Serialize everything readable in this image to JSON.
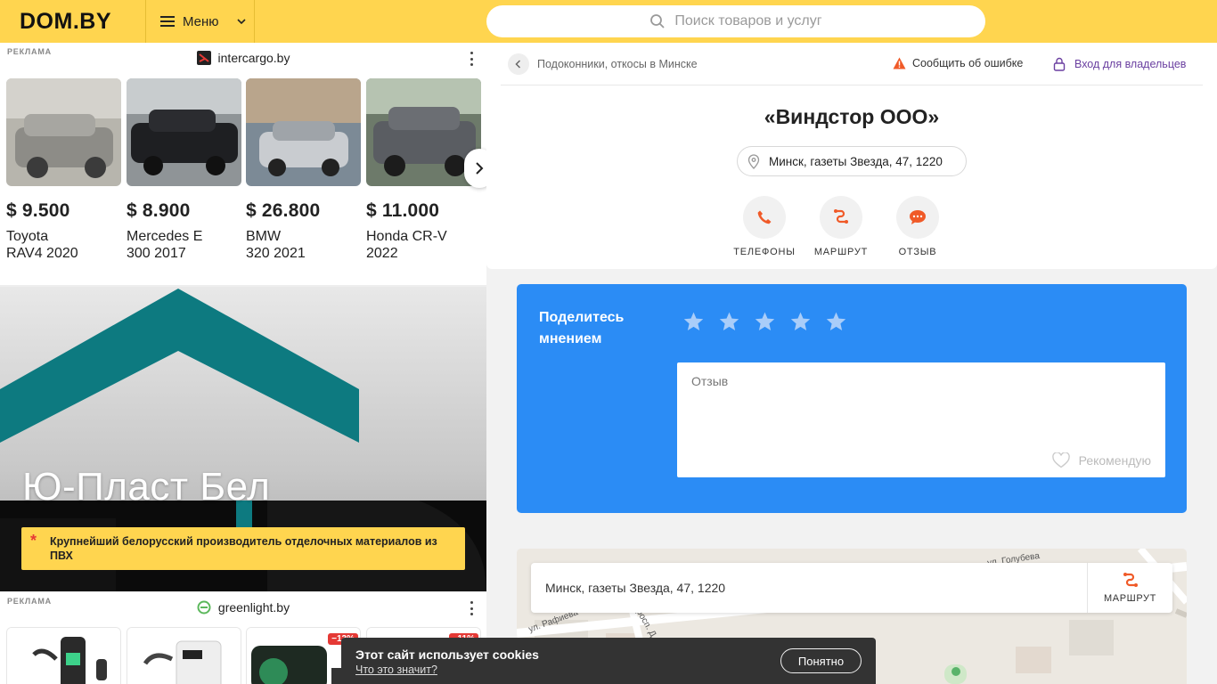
{
  "header": {
    "logo": "DOM.BY",
    "menu_label": "Меню",
    "search_placeholder": "Поиск товаров и услуг"
  },
  "ads": {
    "label": "РЕКЛАМА",
    "block1_brand": "intercargo.by",
    "cars": [
      {
        "price": "$ 9.500",
        "title_line1": "Toyota",
        "title_line2": "RAV4 2020"
      },
      {
        "price": "$ 8.900",
        "title_line1": "Mercedes E",
        "title_line2": "300 2017"
      },
      {
        "price": "$ 26.800",
        "title_line1": "BMW",
        "title_line2": "320 2021"
      },
      {
        "price": "$ 11.000",
        "title_line1": "Honda CR-V",
        "title_line2": "2022"
      }
    ],
    "banner_title": "Ю-Пласт Бел",
    "banner_tagline": "Крупнейший белорусский производитель отделочных материалов из ПВХ",
    "block2_brand": "greenlight.by",
    "discounts": [
      "−13%",
      "−11%"
    ]
  },
  "card": {
    "breadcrumb": "Подоконники, откосы в Минске",
    "report_label": "Сообщить об ошибке",
    "owners_label": "Вход для владельцев",
    "company_name": "«Виндстор ООО»",
    "address": "Минск, газеты Звезда, 47, 1220",
    "actions": [
      "ТЕЛЕФОНЫ",
      "МАРШРУТ",
      "ОТЗЫВ"
    ]
  },
  "review": {
    "title": "Поделитесь мнением",
    "placeholder": "Отзыв",
    "recommend_label": "Рекомендую",
    "stars_count": 5
  },
  "map": {
    "address": "Минск, газеты Звезда, 47, 1220",
    "route_label": "МАРШРУТ",
    "streets": [
      "ул. Голубева",
      "ул. Рафиева",
      "просп. Д"
    ]
  },
  "cookie": {
    "text": "Этот сайт использует cookies",
    "link": "Что это значит?",
    "button": "Понятно"
  },
  "colors": {
    "header_yellow": "#ffd54f",
    "review_blue": "#2b8cf5",
    "accent_orange": "#f05a28",
    "owners_purple": "#6a3fa0"
  }
}
